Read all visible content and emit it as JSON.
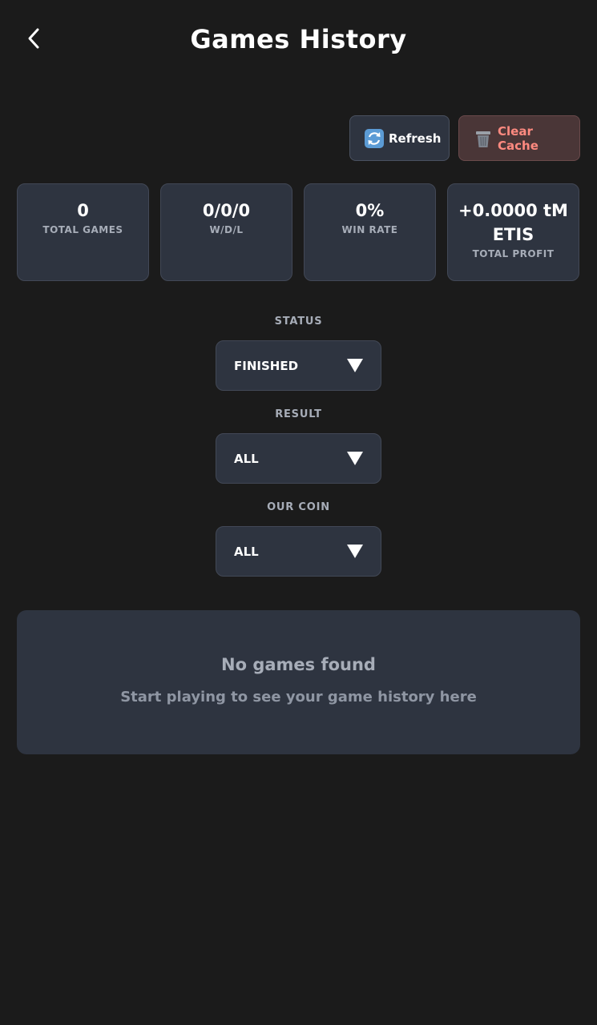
{
  "header": {
    "title": "Games History",
    "back_icon": "chevron-left-icon"
  },
  "actions": {
    "refresh_label": "Refresh",
    "refresh_icon": "refresh-icon",
    "clear_label": "Clear Cache",
    "clear_icon": "trash-icon",
    "clear_color": "#ff8a80"
  },
  "stats": [
    {
      "value": "0",
      "label": "TOTAL GAMES"
    },
    {
      "value": "0/0/0",
      "label": "W/D/L"
    },
    {
      "value": "0%",
      "label": "WIN RATE"
    },
    {
      "value": "+0.0000 tMETIS",
      "label": "TOTAL PROFIT"
    }
  ],
  "filters": {
    "status": {
      "label": "STATUS",
      "value": "FINISHED"
    },
    "result": {
      "label": "RESULT",
      "value": "ALL"
    },
    "our_coin": {
      "label": "OUR COIN",
      "value": "ALL"
    }
  },
  "empty": {
    "title": "No games found",
    "subtitle": "Start playing to see your game history here"
  },
  "colors": {
    "background": "#1b1b1b",
    "card": "#2e3440",
    "muted_text": "#a7adb8"
  }
}
